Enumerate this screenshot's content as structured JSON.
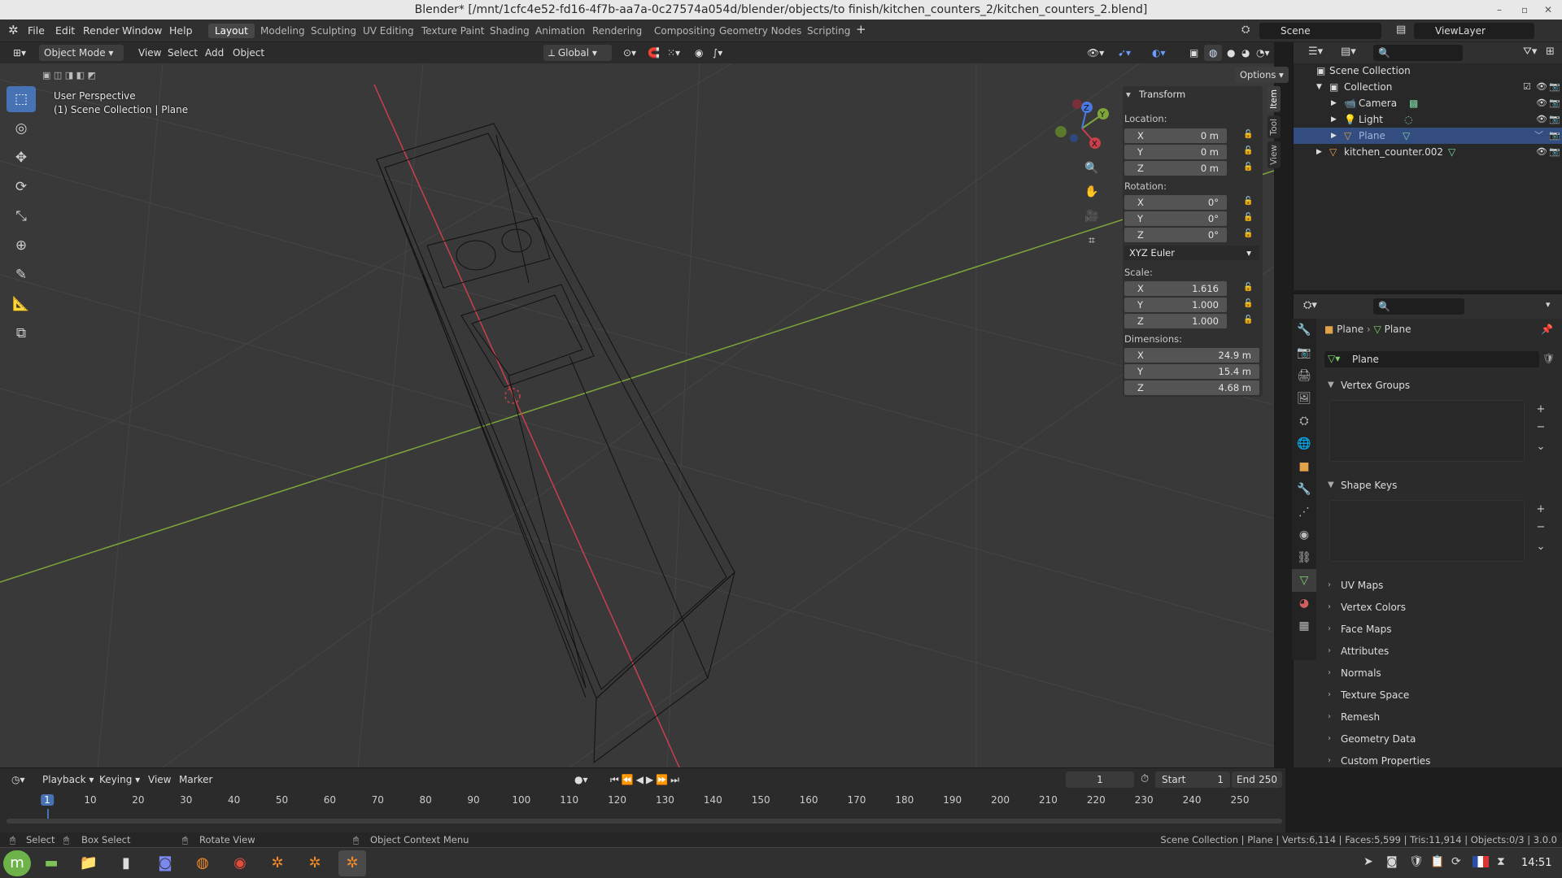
{
  "window": {
    "title": "Blender* [/mnt/1cfc4e52-fd16-4f7b-aa7a-0c27574a054d/blender/objects/to finish/kitchen_counters_2/kitchen_counters_2.blend]"
  },
  "menu": {
    "file": "File",
    "edit": "Edit",
    "render": "Render",
    "window": "Window",
    "help": "Help"
  },
  "workspaces": [
    "Layout",
    "Modeling",
    "Sculpting",
    "UV Editing",
    "Texture Paint",
    "Shading",
    "Animation",
    "Rendering",
    "Compositing",
    "Geometry Nodes",
    "Scripting"
  ],
  "active_workspace": "Layout",
  "scene": {
    "name": "Scene",
    "viewlayer": "ViewLayer"
  },
  "viewport_header": {
    "mode": "Object Mode",
    "view": "View",
    "select": "Select",
    "add": "Add",
    "object": "Object",
    "orientation": "Global",
    "options": "Options"
  },
  "viewport": {
    "perspective": "User Perspective",
    "context": "(1) Scene Collection | Plane"
  },
  "npanel": {
    "tabs": [
      "Item",
      "Tool",
      "View"
    ],
    "header": "Transform",
    "location_label": "Location:",
    "location": {
      "x": "0 m",
      "y": "0 m",
      "z": "0 m"
    },
    "rotation_label": "Rotation:",
    "rotation": {
      "x": "0°",
      "y": "0°",
      "z": "0°"
    },
    "rotation_mode": "XYZ Euler",
    "scale_label": "Scale:",
    "scale": {
      "x": "1.616",
      "y": "1.000",
      "z": "1.000"
    },
    "dimensions_label": "Dimensions:",
    "dimensions": {
      "x": "24.9 m",
      "y": "15.4 m",
      "z": "4.68 m"
    },
    "axis": {
      "x": "X",
      "y": "Y",
      "z": "Z"
    }
  },
  "outliner": {
    "root": "Scene Collection",
    "items": [
      "Collection",
      "Camera",
      "Light",
      "Plane",
      "kitchen_counter.002"
    ]
  },
  "properties": {
    "breadcrumb_object": "Plane",
    "breadcrumb_data": "Plane",
    "mesh_name": "Plane",
    "sections": [
      "Vertex Groups",
      "Shape Keys",
      "UV Maps",
      "Vertex Colors",
      "Face Maps",
      "Attributes",
      "Normals",
      "Texture Space",
      "Remesh",
      "Geometry Data",
      "Custom Properties"
    ]
  },
  "timeline": {
    "playback": "Playback",
    "keying": "Keying",
    "view": "View",
    "marker": "Marker",
    "current_frame": "1",
    "start_label": "Start",
    "start": "1",
    "end_label": "End",
    "end": "250",
    "ticks": [
      "1",
      "10",
      "20",
      "30",
      "40",
      "50",
      "60",
      "70",
      "80",
      "90",
      "100",
      "110",
      "120",
      "130",
      "140",
      "150",
      "160",
      "170",
      "180",
      "190",
      "200",
      "210",
      "220",
      "230",
      "240",
      "250"
    ]
  },
  "statusbar": {
    "select": "Select",
    "box_select": "Box Select",
    "rotate_view": "Rotate View",
    "context_menu": "Object Context Menu",
    "stats": "Scene Collection | Plane | Verts:6,114 | Faces:5,599 | Tris:11,914 | Objects:0/3 | 3.0.0"
  },
  "taskbar": {
    "clock": "14:51"
  },
  "colors": {
    "accent": "#4772b3",
    "axis_x": "#c8404a",
    "axis_y": "#7ea63a",
    "selected_row": "#334d80"
  }
}
